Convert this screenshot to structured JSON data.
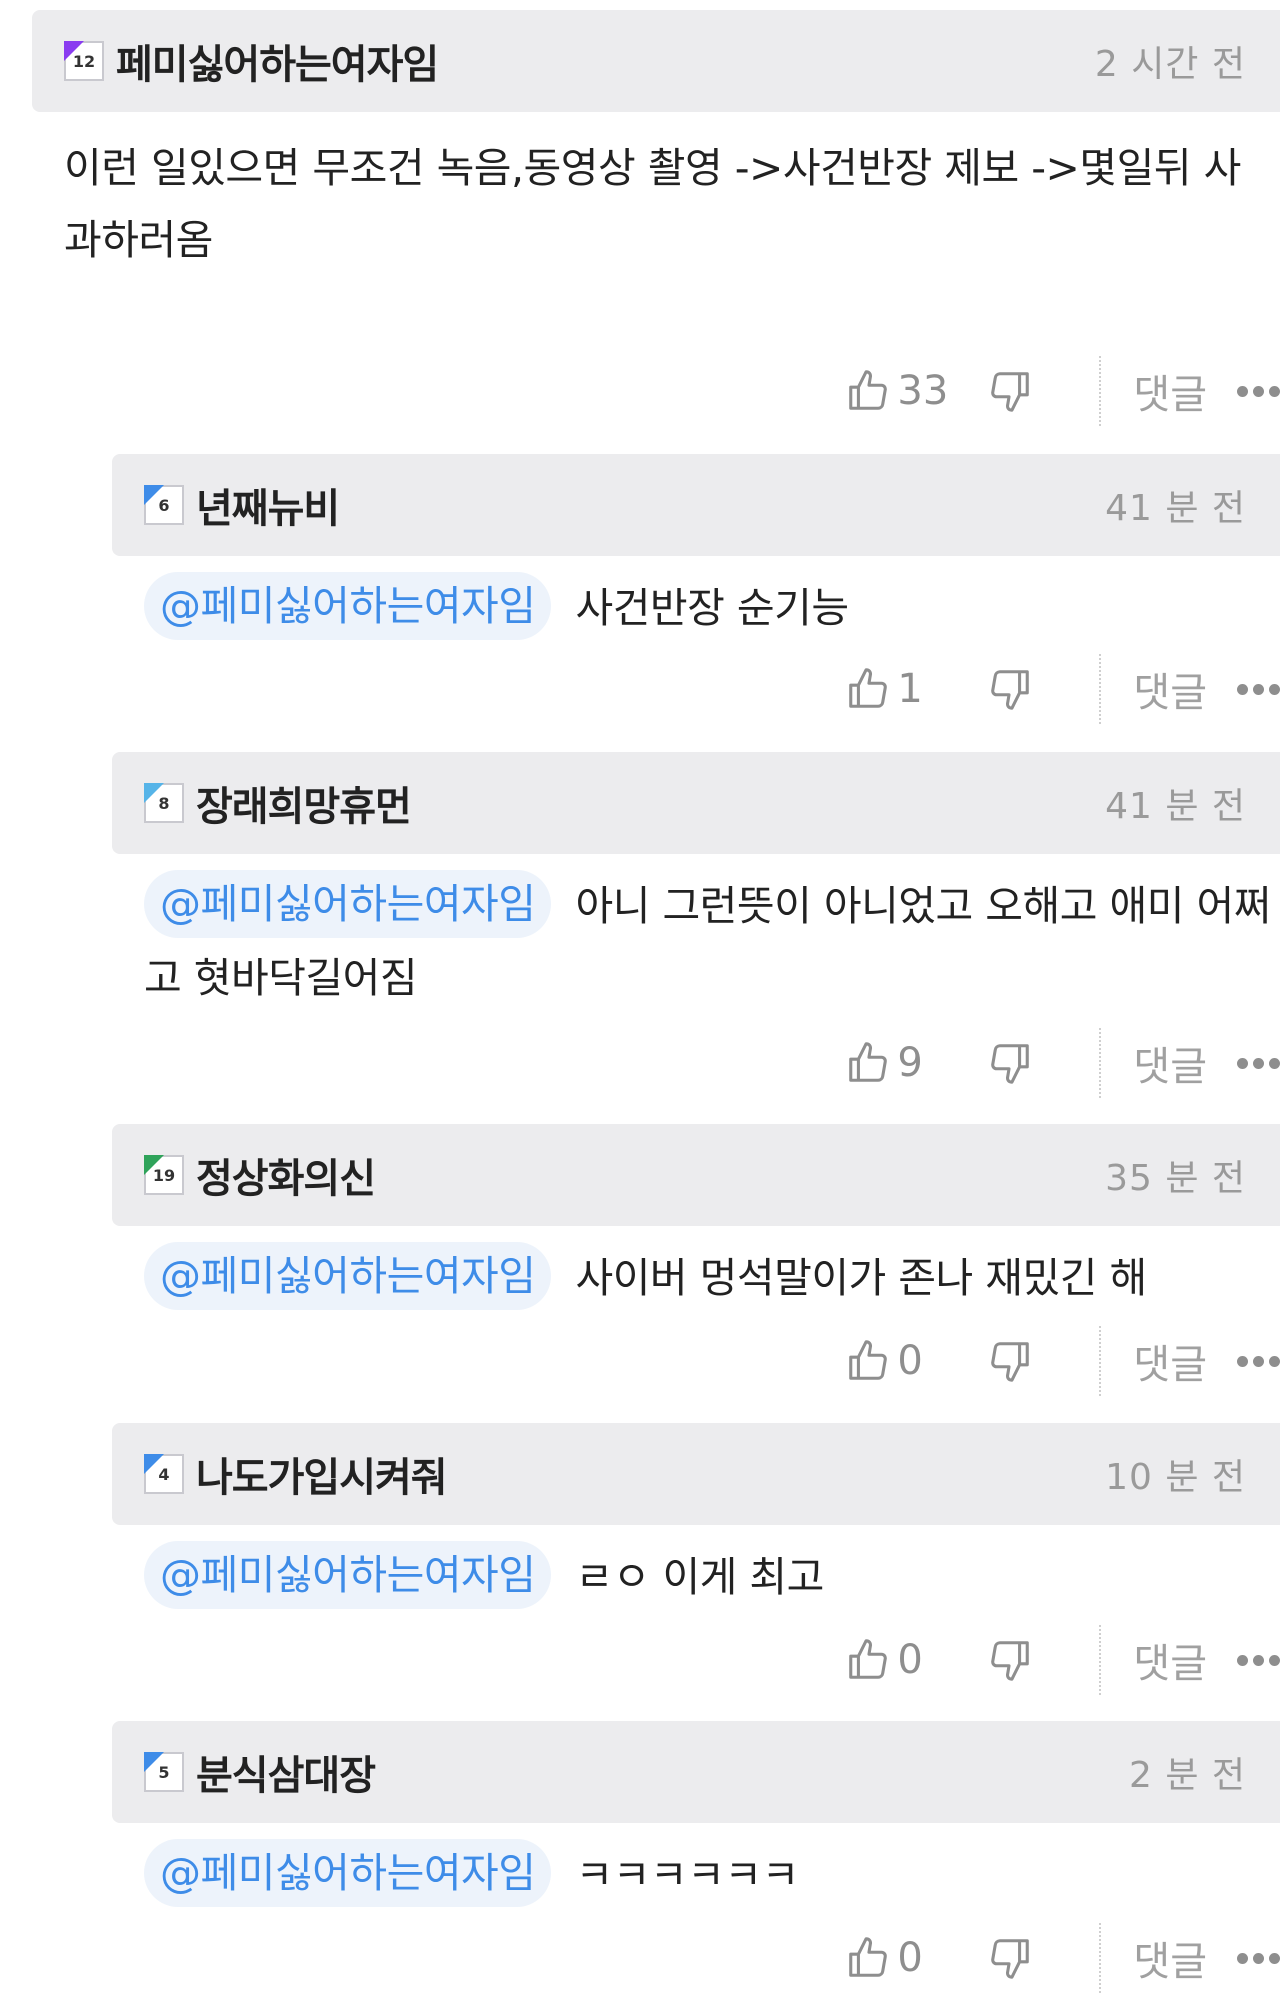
{
  "colors": {
    "header_bg": "#ececee",
    "mention_bg": "#edf3fb",
    "mention_text": "#3e8ce8",
    "muted_text": "#9a9a9a"
  },
  "icons": {
    "like": "thumbs-up-icon",
    "dislike": "thumbs-down-icon",
    "more": "more-dots-icon"
  },
  "labels": {
    "reply": "댓글"
  },
  "comments": [
    {
      "level": "12",
      "level_color": "#8a3cf0",
      "nickname": "페미싫어하는여자임",
      "time": "2 시간 전",
      "mention": "",
      "text": "이런 일있으면 무조건 녹음,동영상 촬영 ->사건반장 제보 ->몇일뒤 사과하러옴",
      "likes": "33"
    },
    {
      "level": "6",
      "level_color": "#3e8ce8",
      "nickname": "년째뉴비",
      "time": "41 분 전",
      "mention": "@페미싫어하는여자임",
      "text": "사건반장 순기능",
      "likes": "1"
    },
    {
      "level": "8",
      "level_color": "#56b4e8",
      "nickname": "장래희망휴먼",
      "time": "41 분 전",
      "mention": "@페미싫어하는여자임",
      "text": "아니 그런뜻이 아니었고 오해고 애미 어쩌고 혓바닥길어짐",
      "likes": "9"
    },
    {
      "level": "19",
      "level_color": "#2fa35a",
      "nickname": "정상화의신",
      "time": "35 분 전",
      "mention": "@페미싫어하는여자임",
      "text": "사이버 멍석말이가 존나 재밌긴 해",
      "likes": "0"
    },
    {
      "level": "4",
      "level_color": "#3e8ce8",
      "nickname": "나도가입시켜줘",
      "time": "10 분 전",
      "mention": "@페미싫어하는여자임",
      "text": "ㄹㅇ 이게 최고",
      "likes": "0"
    },
    {
      "level": "5",
      "level_color": "#3e8ce8",
      "nickname": "분식삼대장",
      "time": "2 분 전",
      "mention": "@페미싫어하는여자임",
      "text": "ㅋㅋㅋㅋㅋㅋ",
      "likes": "0"
    }
  ]
}
